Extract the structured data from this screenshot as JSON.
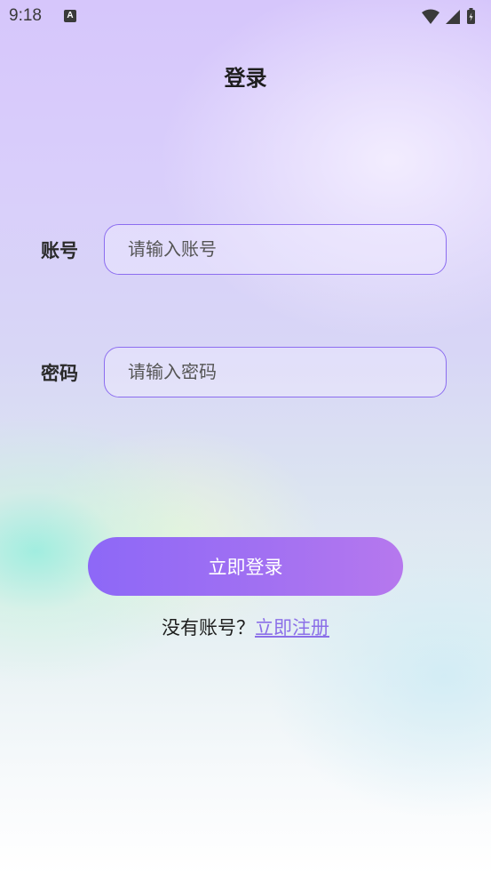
{
  "status_bar": {
    "time": "9:18",
    "notification_icon_letter": "A",
    "icons": [
      "wifi-icon",
      "signal-icon",
      "battery-icon"
    ]
  },
  "header": {
    "title": "登录"
  },
  "form": {
    "account": {
      "label": "账号",
      "placeholder": "请输入账号",
      "value": ""
    },
    "password": {
      "label": "密码",
      "placeholder": "请输入密码",
      "value": ""
    },
    "login_button_label": "立即登录"
  },
  "register": {
    "prompt": "没有账号？",
    "link_label": "立即注册"
  },
  "colors": {
    "accent": "#8c6df0",
    "button_gradient_start": "#8d68f7",
    "button_gradient_end": "#b678ee",
    "link": "#8b6fe8"
  }
}
